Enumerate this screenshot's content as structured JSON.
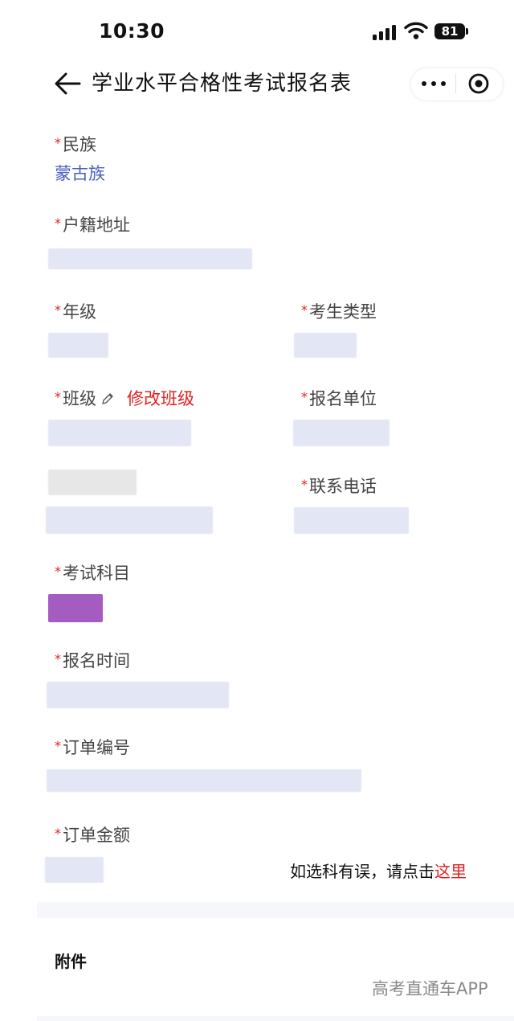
{
  "status_bar": {
    "time": "10:30",
    "battery": "81"
  },
  "nav": {
    "title": "学业水平合格性考试报名表"
  },
  "fields": {
    "ethnicity": {
      "label": "民族",
      "value": "蒙古族"
    },
    "hukou_address": {
      "label": "户籍地址"
    },
    "grade": {
      "label": "年级"
    },
    "candidate_type": {
      "label": "考生类型"
    },
    "class": {
      "label": "班级",
      "edit_label": "修改班级"
    },
    "registration_unit": {
      "label": "报名单位"
    },
    "contact_phone": {
      "label": "联系电话"
    },
    "exam_subject": {
      "label": "考试科目"
    },
    "registration_time": {
      "label": "报名时间"
    },
    "order_number": {
      "label": "订单编号"
    },
    "order_amount": {
      "label": "订单金额"
    }
  },
  "required_mark": "*",
  "hint": {
    "text": "如选科有误，请点击",
    "link": "这里"
  },
  "attachments": {
    "title": "附件"
  },
  "watermark": "高考直通车APP",
  "colors": {
    "required": "#e02020",
    "link": "#e02020",
    "value": "#4a5fc1",
    "subject_tag": "#a45cc0"
  }
}
